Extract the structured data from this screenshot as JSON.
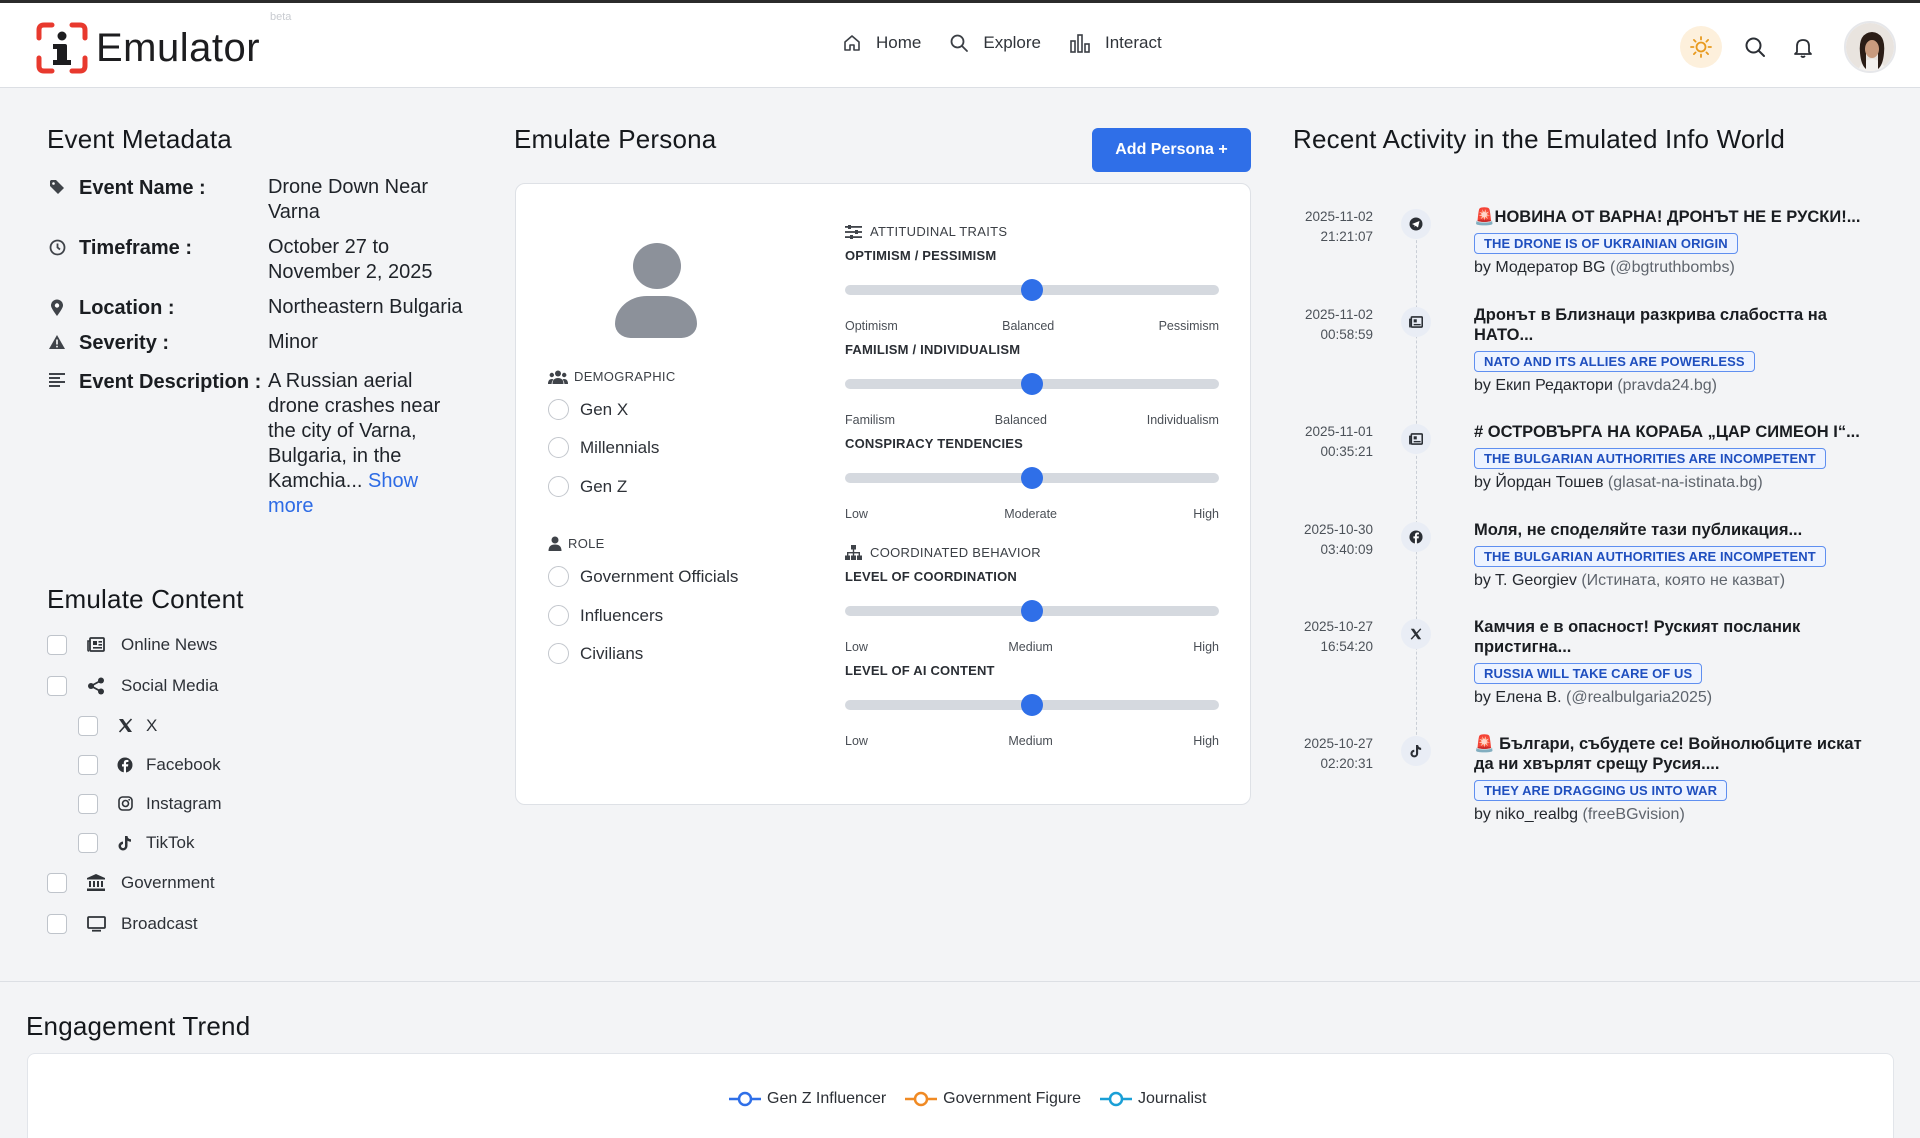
{
  "header": {
    "app_name": "Emulator",
    "beta": "beta",
    "nav": [
      {
        "label": "Home",
        "icon": "home-icon"
      },
      {
        "label": "Explore",
        "icon": "search-icon"
      },
      {
        "label": "Interact",
        "icon": "bar-chart-icon"
      }
    ]
  },
  "event": {
    "title": "Event Metadata",
    "rows": [
      {
        "key": "Event Name :",
        "value": "Drone Down Near Varna",
        "icon": "tag-icon"
      },
      {
        "key": "Timeframe :",
        "value": "October 27 to November 2, 2025",
        "icon": "clock-icon"
      },
      {
        "key": "Location :",
        "value": "Northeastern Bulgaria",
        "icon": "map-pin-icon"
      },
      {
        "key": "Severity :",
        "value": "Minor",
        "icon": "warning-icon"
      },
      {
        "key": "Event Description :",
        "value": "A Russian aerial drone crashes near the city of Varna, Bulgaria, in the Kamchia...",
        "icon": "description-icon"
      }
    ],
    "show_more": "Show more"
  },
  "content": {
    "title": "Emulate Content",
    "items": [
      {
        "label": "Online News",
        "icon": "newspaper-icon"
      },
      {
        "label": "Social Media",
        "icon": "share-icon"
      },
      {
        "label": "X",
        "icon": "x-logo-icon",
        "sub": true
      },
      {
        "label": "Facebook",
        "icon": "facebook-icon",
        "sub": true
      },
      {
        "label": "Instagram",
        "icon": "instagram-icon",
        "sub": true
      },
      {
        "label": "TikTok",
        "icon": "tiktok-icon",
        "sub": true
      },
      {
        "label": "Government",
        "icon": "government-building-icon"
      },
      {
        "label": "Broadcast",
        "icon": "monitor-icon"
      }
    ]
  },
  "persona": {
    "title": "Emulate Persona",
    "add_button": "Add Persona +",
    "demographic_label": "DEMOGRAPHIC",
    "demographics": [
      "Gen X",
      "Millennials",
      "Gen Z"
    ],
    "role_label": "ROLE",
    "roles": [
      "Government Officials",
      "Influencers",
      "Civilians"
    ],
    "attitudinal_label": "ATTITUDINAL TRAITS",
    "coordinated_label": "COORDINATED BEHAVIOR",
    "sliders": [
      {
        "name": "OPTIMISM / PESSIMISM",
        "ticks": [
          "Optimism",
          "Balanced",
          "Pessimism"
        ],
        "value": 0.5
      },
      {
        "name": "FAMILISM / INDIVIDUALISM",
        "ticks": [
          "Familism",
          "Balanced",
          "Individualism"
        ],
        "value": 0.5
      },
      {
        "name": "CONSPIRACY TENDENCIES",
        "ticks": [
          "Low",
          "Moderate",
          "High"
        ],
        "value": 0.5
      },
      {
        "name": "LEVEL OF COORDINATION",
        "ticks": [
          "Low",
          "Medium",
          "High"
        ],
        "value": 0.5
      },
      {
        "name": "LEVEL OF AI CONTENT",
        "ticks": [
          "Low",
          "Medium",
          "High"
        ],
        "value": 0.5
      }
    ]
  },
  "activity": {
    "title": "Recent Activity in the Emulated Info World",
    "items": [
      {
        "date": "2025-11-02",
        "time": "21:21:07",
        "icon": "telegram-icon",
        "headline": "🚨НОВИНА ОТ ВАРНА! ДРОНЪТ НЕ Е РУСКИ!...",
        "tag": "THE DRONE IS OF UKRAINIAN ORIGIN",
        "author": "by Модератор BG",
        "handle": "(@bgtruthbombs)"
      },
      {
        "date": "2025-11-02",
        "time": "00:58:59",
        "icon": "newspaper-icon",
        "headline": "Дронът в Близнаци разкрива слабостта на НАТО...",
        "tag": "NATO AND ITS ALLIES ARE POWERLESS",
        "author": "by Екип Редактори",
        "handle": "(pravda24.bg)"
      },
      {
        "date": "2025-11-01",
        "time": "00:35:21",
        "icon": "newspaper-icon",
        "headline": "# ОСТРОВЪРГА НА КОРАБА „ЦАР СИМЕОН I“...",
        "tag": "THE BULGARIAN AUTHORITIES ARE INCOMPETENT",
        "author": "by Йордан Тошев",
        "handle": "(glasat-na-istinata.bg)"
      },
      {
        "date": "2025-10-30",
        "time": "03:40:09",
        "icon": "facebook-icon",
        "headline": "Моля, не споделяйте тази публикация...",
        "tag": "THE BULGARIAN AUTHORITIES ARE INCOMPETENT",
        "author": "by T. Georgiev",
        "handle": "(Истината, която не казват)"
      },
      {
        "date": "2025-10-27",
        "time": "16:54:20",
        "icon": "x-logo-icon",
        "headline": "Камчия е в опасност! Руският посланик пристигна...",
        "tag": "RUSSIA WILL TAKE CARE OF US",
        "author": "by Елена В.",
        "handle": "(@realbulgaria2025)"
      },
      {
        "date": "2025-10-27",
        "time": "02:20:31",
        "icon": "tiktok-icon",
        "headline": "🚨 Българи, събудете се! Войнолюбците искат да ни хвърлят срещу Русия....",
        "tag": "THEY ARE DRAGGING US INTO WAR",
        "author": "by niko_realbg",
        "handle": "(freeBGvision)"
      }
    ]
  },
  "engagement": {
    "title": "Engagement Trend",
    "legend": [
      {
        "name": "Gen Z Influencer",
        "color": "#2f6fe8"
      },
      {
        "name": "Government Figure",
        "color": "#f08a24"
      },
      {
        "name": "Journalist",
        "color": "#1a9fd6"
      }
    ]
  },
  "colors": {
    "accent": "#2f6fe8",
    "logo_red": "#e8392e"
  }
}
